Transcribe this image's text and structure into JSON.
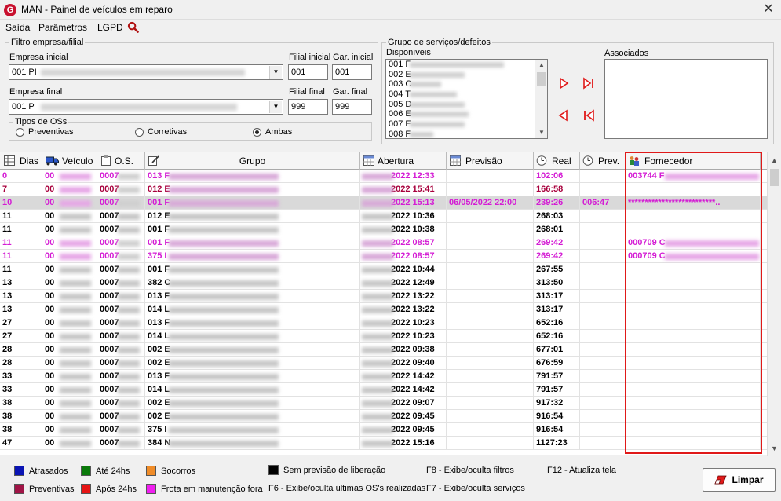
{
  "window": {
    "title": "MAN - Painel de veículos em reparo",
    "logo_letter": "G",
    "close_glyph": "✕"
  },
  "menu": {
    "items": [
      "Saída",
      "Parâmetros",
      "LGPD"
    ]
  },
  "filtro": {
    "legend": "Filtro empresa/filial",
    "empresa_inicial_label": "Empresa inicial",
    "empresa_inicial_value": "001 PI",
    "filial_inicial_label": "Filial inicial",
    "filial_inicial_value": "001",
    "gar_inicial_label": "Gar. inicial",
    "gar_inicial_value": "001",
    "empresa_final_label": "Empresa final",
    "empresa_final_value": "001 P",
    "filial_final_label": "Filial final",
    "filial_final_value": "999",
    "gar_final_label": "Gar. final",
    "gar_final_value": "999",
    "tipos_legend": "Tipos de OSs",
    "tipos": [
      {
        "label": "Preventivas",
        "checked": false
      },
      {
        "label": "Corretivas",
        "checked": false
      },
      {
        "label": "Ambas",
        "checked": true
      }
    ]
  },
  "grupo": {
    "legend": "Grupo de serviços/defeitos",
    "disponiveis_label": "Disponíveis",
    "disponiveis": [
      "001 F",
      "002 E",
      "003 C",
      "004 T",
      "005 D",
      "006 E",
      "007 E",
      "008 F"
    ],
    "associados_label": "Associados"
  },
  "grid": {
    "columns": [
      "Dias",
      "Veículo",
      "O.S.",
      "Grupo",
      "Abertura",
      "Previsão",
      "Real",
      "Prev.",
      "Fornecedor"
    ],
    "rows": [
      {
        "dias": "0",
        "veiculo": "00",
        "os": "0007",
        "grupo": "013 F",
        "abertura": "2022 12:33",
        "previsao": "",
        "real": "102:06",
        "prev": "",
        "fornecedor": "003744 F",
        "color": "magenta",
        "selected": false
      },
      {
        "dias": "7",
        "veiculo": "00",
        "os": "0007",
        "grupo": "012 E",
        "abertura": "2022 15:41",
        "previsao": "",
        "real": "166:58",
        "prev": "",
        "fornecedor": "",
        "color": "crimson",
        "selected": false
      },
      {
        "dias": "10",
        "veiculo": "00",
        "os": "0007",
        "grupo": "001 F",
        "abertura": "2022 15:13",
        "previsao": "06/05/2022 22:00",
        "real": "239:26",
        "prev": "006:47",
        "fornecedor": "**************************..",
        "color": "magenta",
        "selected": true
      },
      {
        "dias": "11",
        "veiculo": "00",
        "os": "0007",
        "grupo": "012 E",
        "abertura": "2022 10:36",
        "previsao": "",
        "real": "268:03",
        "prev": "",
        "fornecedor": "",
        "color": "black",
        "selected": false
      },
      {
        "dias": "11",
        "veiculo": "00",
        "os": "0007",
        "grupo": "001 F",
        "abertura": "2022 10:38",
        "previsao": "",
        "real": "268:01",
        "prev": "",
        "fornecedor": "",
        "color": "black",
        "selected": false
      },
      {
        "dias": "11",
        "veiculo": "00",
        "os": "0007",
        "grupo": "001 F",
        "abertura": "2022 08:57",
        "previsao": "",
        "real": "269:42",
        "prev": "",
        "fornecedor": "000709 C",
        "color": "magenta",
        "selected": false
      },
      {
        "dias": "11",
        "veiculo": "00",
        "os": "0007",
        "grupo": "375 I",
        "abertura": "2022 08:57",
        "previsao": "",
        "real": "269:42",
        "prev": "",
        "fornecedor": "000709 C",
        "color": "magenta",
        "selected": false
      },
      {
        "dias": "11",
        "veiculo": "00",
        "os": "0007",
        "grupo": "001 F",
        "abertura": "2022 10:44",
        "previsao": "",
        "real": "267:55",
        "prev": "",
        "fornecedor": "",
        "color": "black",
        "selected": false
      },
      {
        "dias": "13",
        "veiculo": "00",
        "os": "0007",
        "grupo": "382 C",
        "abertura": "2022 12:49",
        "previsao": "",
        "real": "313:50",
        "prev": "",
        "fornecedor": "",
        "color": "black",
        "selected": false
      },
      {
        "dias": "13",
        "veiculo": "00",
        "os": "0007",
        "grupo": "013 F",
        "abertura": "2022 13:22",
        "previsao": "",
        "real": "313:17",
        "prev": "",
        "fornecedor": "",
        "color": "black",
        "selected": false
      },
      {
        "dias": "13",
        "veiculo": "00",
        "os": "0007",
        "grupo": "014 L",
        "abertura": "2022 13:22",
        "previsao": "",
        "real": "313:17",
        "prev": "",
        "fornecedor": "",
        "color": "black",
        "selected": false
      },
      {
        "dias": "27",
        "veiculo": "00",
        "os": "0007",
        "grupo": "013 F",
        "abertura": "2022 10:23",
        "previsao": "",
        "real": "652:16",
        "prev": "",
        "fornecedor": "",
        "color": "black",
        "selected": false
      },
      {
        "dias": "27",
        "veiculo": "00",
        "os": "0007",
        "grupo": "014 L",
        "abertura": "2022 10:23",
        "previsao": "",
        "real": "652:16",
        "prev": "",
        "fornecedor": "",
        "color": "black",
        "selected": false
      },
      {
        "dias": "28",
        "veiculo": "00",
        "os": "0007",
        "grupo": "002 E",
        "abertura": "2022 09:38",
        "previsao": "",
        "real": "677:01",
        "prev": "",
        "fornecedor": "",
        "color": "black",
        "selected": false
      },
      {
        "dias": "28",
        "veiculo": "00",
        "os": "0007",
        "grupo": "002 E",
        "abertura": "2022 09:40",
        "previsao": "",
        "real": "676:59",
        "prev": "",
        "fornecedor": "",
        "color": "black",
        "selected": false
      },
      {
        "dias": "33",
        "veiculo": "00",
        "os": "0007",
        "grupo": "013 F",
        "abertura": "2022 14:42",
        "previsao": "",
        "real": "791:57",
        "prev": "",
        "fornecedor": "",
        "color": "black",
        "selected": false
      },
      {
        "dias": "33",
        "veiculo": "00",
        "os": "0007",
        "grupo": "014 L",
        "abertura": "2022 14:42",
        "previsao": "",
        "real": "791:57",
        "prev": "",
        "fornecedor": "",
        "color": "black",
        "selected": false
      },
      {
        "dias": "38",
        "veiculo": "00",
        "os": "0007",
        "grupo": "002 E",
        "abertura": "2022 09:07",
        "previsao": "",
        "real": "917:32",
        "prev": "",
        "fornecedor": "",
        "color": "black",
        "selected": false
      },
      {
        "dias": "38",
        "veiculo": "00",
        "os": "0007",
        "grupo": "002 E",
        "abertura": "2022 09:45",
        "previsao": "",
        "real": "916:54",
        "prev": "",
        "fornecedor": "",
        "color": "black",
        "selected": false
      },
      {
        "dias": "38",
        "veiculo": "00",
        "os": "0007",
        "grupo": "375 I",
        "abertura": "2022 09:45",
        "previsao": "",
        "real": "916:54",
        "prev": "",
        "fornecedor": "",
        "color": "black",
        "selected": false
      },
      {
        "dias": "47",
        "veiculo": "00",
        "os": "0007",
        "grupo": "384 N",
        "abertura": "2022 15:16",
        "previsao": "",
        "real": "1127:23",
        "prev": "",
        "fornecedor": "",
        "color": "black",
        "selected": false
      }
    ]
  },
  "legend": [
    {
      "label": "Atrasados",
      "color": "#0a14b4"
    },
    {
      "label": "Até 24hs",
      "color": "#0a7a0a"
    },
    {
      "label": "Socorros",
      "color": "#f08c28"
    },
    {
      "label": "Sem previsão de liberação",
      "color": "#000000"
    },
    {
      "label": "Preventivas",
      "color": "#a01446"
    },
    {
      "label": "Após 24hs",
      "color": "#e61414"
    },
    {
      "label": "Frota em manutenção fora",
      "color": "#f01ef0"
    }
  ],
  "hints": [
    "F6 - Exibe/oculta últimas OS's realizadas",
    "F8 - Exibe/oculta filtros",
    "F7 - Exibe/oculta serviços",
    "F12 - Atualiza tela"
  ],
  "limpar_label": "Limpar",
  "colors": {
    "magenta": "#d41cd4",
    "crimson": "#a8003c",
    "black": "#000000",
    "highlight": "#e01919"
  }
}
